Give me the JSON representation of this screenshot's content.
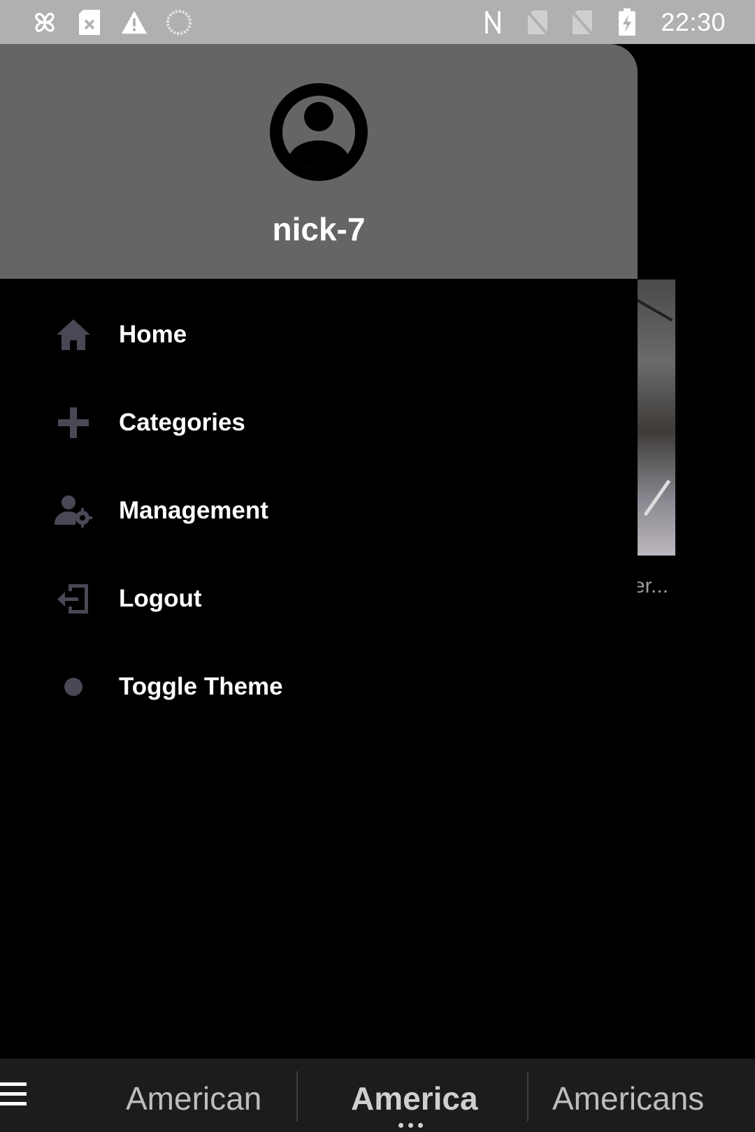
{
  "status_bar": {
    "time": "22:30",
    "left_icons": [
      "pinwheel-icon",
      "sim-card-x-icon",
      "warning-icon",
      "loading-circle-icon"
    ],
    "right_icons": [
      "nfc-icon",
      "no-sim-icon",
      "no-sim-icon",
      "battery-charging-icon"
    ]
  },
  "drawer": {
    "header": {
      "avatar_icon": "account-circle-icon",
      "username": "nick-7"
    },
    "items": [
      {
        "label": "Home",
        "icon": "home-icon"
      },
      {
        "label": "Categories",
        "icon": "plus-icon"
      },
      {
        "label": "Management",
        "icon": "user-settings-icon"
      },
      {
        "label": "Logout",
        "icon": "logout-icon"
      },
      {
        "label": "Toggle Theme",
        "icon": "dot-icon"
      }
    ]
  },
  "background": {
    "caption_fragment": "er..."
  },
  "keyboard_suggestions": {
    "menu_icon": "hamburger-icon",
    "items": [
      "American",
      "America",
      "Americans"
    ],
    "selected_index": 1
  },
  "colors": {
    "status_bar": "#b0b0b0",
    "drawer_header": "#656565",
    "drawer_body": "#000000",
    "icon_tint": "#4a4855",
    "suggestion_bar": "#1c1c1c"
  }
}
